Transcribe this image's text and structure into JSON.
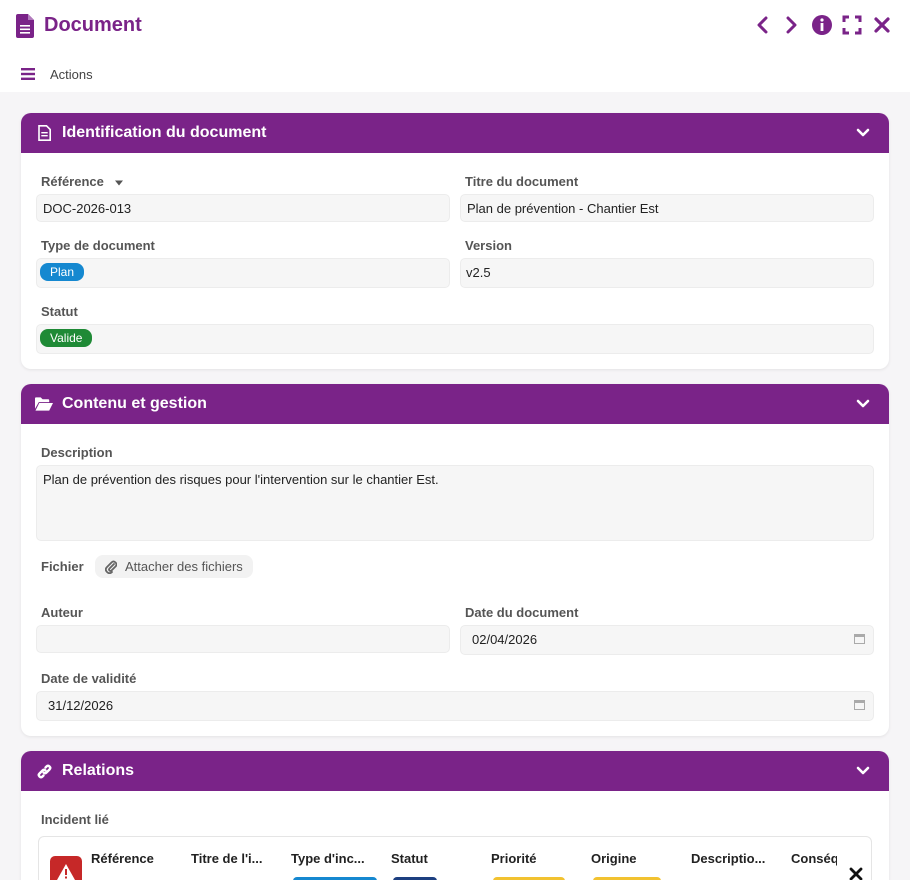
{
  "window": {
    "title": "Document",
    "controls": [
      "chevron-left-icon",
      "chevron-right-icon",
      "info-icon",
      "fullscreen-icon",
      "close-icon"
    ],
    "accent": "#7a2388"
  },
  "actions": {
    "label": "Actions"
  },
  "sections": {
    "identification": {
      "title": "Identification du document",
      "reference_label": "Référence",
      "reference_value": "DOC-2026-013",
      "titre_label": "Titre du document",
      "titre_value": "Plan de prévention - Chantier Est",
      "type_label": "Type de document",
      "type_value": "Plan",
      "type_color": "#1588d0",
      "version_label": "Version",
      "version_value": "v2.5",
      "statut_label": "Statut",
      "statut_value": "Valide",
      "statut_color": "#1f8a36"
    },
    "contenu": {
      "title": "Contenu et gestion",
      "description_label": "Description",
      "description_value": "Plan de prévention des risques pour l'intervention sur le chantier Est.",
      "fichier_label": "Fichier",
      "attach_label": "Attacher des fichiers",
      "auteur_label": "Auteur",
      "auteur_value": "",
      "date_doc_label": "Date du document",
      "date_doc_value": "02/04/2026",
      "date_validite_label": "Date de validité",
      "date_validite_value": "31/12/2026"
    },
    "relations": {
      "title": "Relations",
      "incident_label": "Incident lié",
      "columns": [
        "Référence",
        "Titre de l'i...",
        "Type d'inc...",
        "Statut",
        "Priorité",
        "Origine",
        "Descriptio...",
        "Conséq"
      ]
    }
  }
}
